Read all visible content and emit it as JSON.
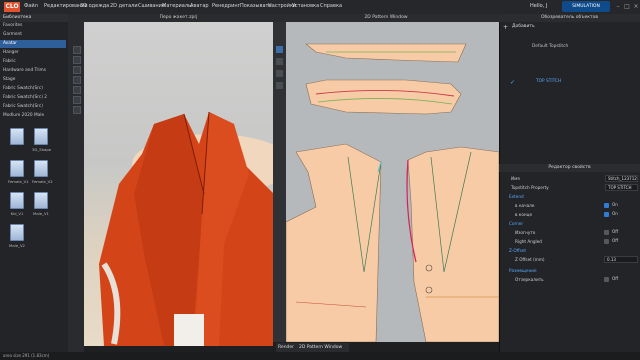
{
  "menu": {
    "logo": "CLO",
    "items": [
      "Файл",
      "Редактирование",
      "3D одежда",
      "2D детали",
      "Сшивание",
      "Материалы",
      "Аватар",
      "Ренедринг",
      "Показывать",
      "Настройки",
      "Установка",
      "Справка"
    ],
    "user": "Hello, J",
    "mode": "SIMULATION"
  },
  "library": {
    "header": "Библиотека",
    "items": [
      "Favorites",
      "Garment",
      "Avatar",
      "Hanger",
      "Fabric",
      "Hardware and Trims",
      "Stage",
      "Fabric Swatch(Src)",
      "Fabric Swatch(Src) 2",
      "Fabric Swatch(Src)",
      "Modlure 2020 Male"
    ],
    "selected_index": 2,
    "files": [
      "",
      "3D_Shape",
      "Female_V1",
      "Female_V2",
      "Kid_V1",
      "Male_V1",
      "Male_V2"
    ]
  },
  "view3d": {
    "tab": "Перо жакет.zprj"
  },
  "view2d": {
    "tab": "2D Pattern Window",
    "bottom_tabs": [
      "Render",
      "2D Pattern Window"
    ]
  },
  "object_browser": {
    "title": "Обозреватель объектов",
    "add_label": "Добавить",
    "items": [
      "Default Topstitch",
      "TOP STITCH"
    ],
    "selected_index": 1
  },
  "property_editor": {
    "title": "Редактор свойств",
    "name_label": "Имя",
    "name_value": "Stitch_123712",
    "type_label": "Topstitch Property",
    "type_value": "TOP STITCH",
    "sections": {
      "extend": "Extend",
      "corner": "Corner",
      "z_offset": "Z-Offset",
      "placement": "Размещение"
    },
    "rows": [
      {
        "label": "в начале",
        "value": "On",
        "state": "on"
      },
      {
        "label": "в конце",
        "value": "On",
        "state": "on"
      },
      {
        "label": "Изогнуто",
        "value": "Off",
        "state": "off"
      },
      {
        "label": "Right Angled",
        "value": "Off",
        "state": "off"
      },
      {
        "label": "Z Offset (mm)",
        "value": "0.13",
        "state": "field"
      },
      {
        "label": "Отзеркалить",
        "value": "Off",
        "state": "off"
      }
    ]
  },
  "status": {
    "text": "area size 291 (1.83cm)"
  }
}
